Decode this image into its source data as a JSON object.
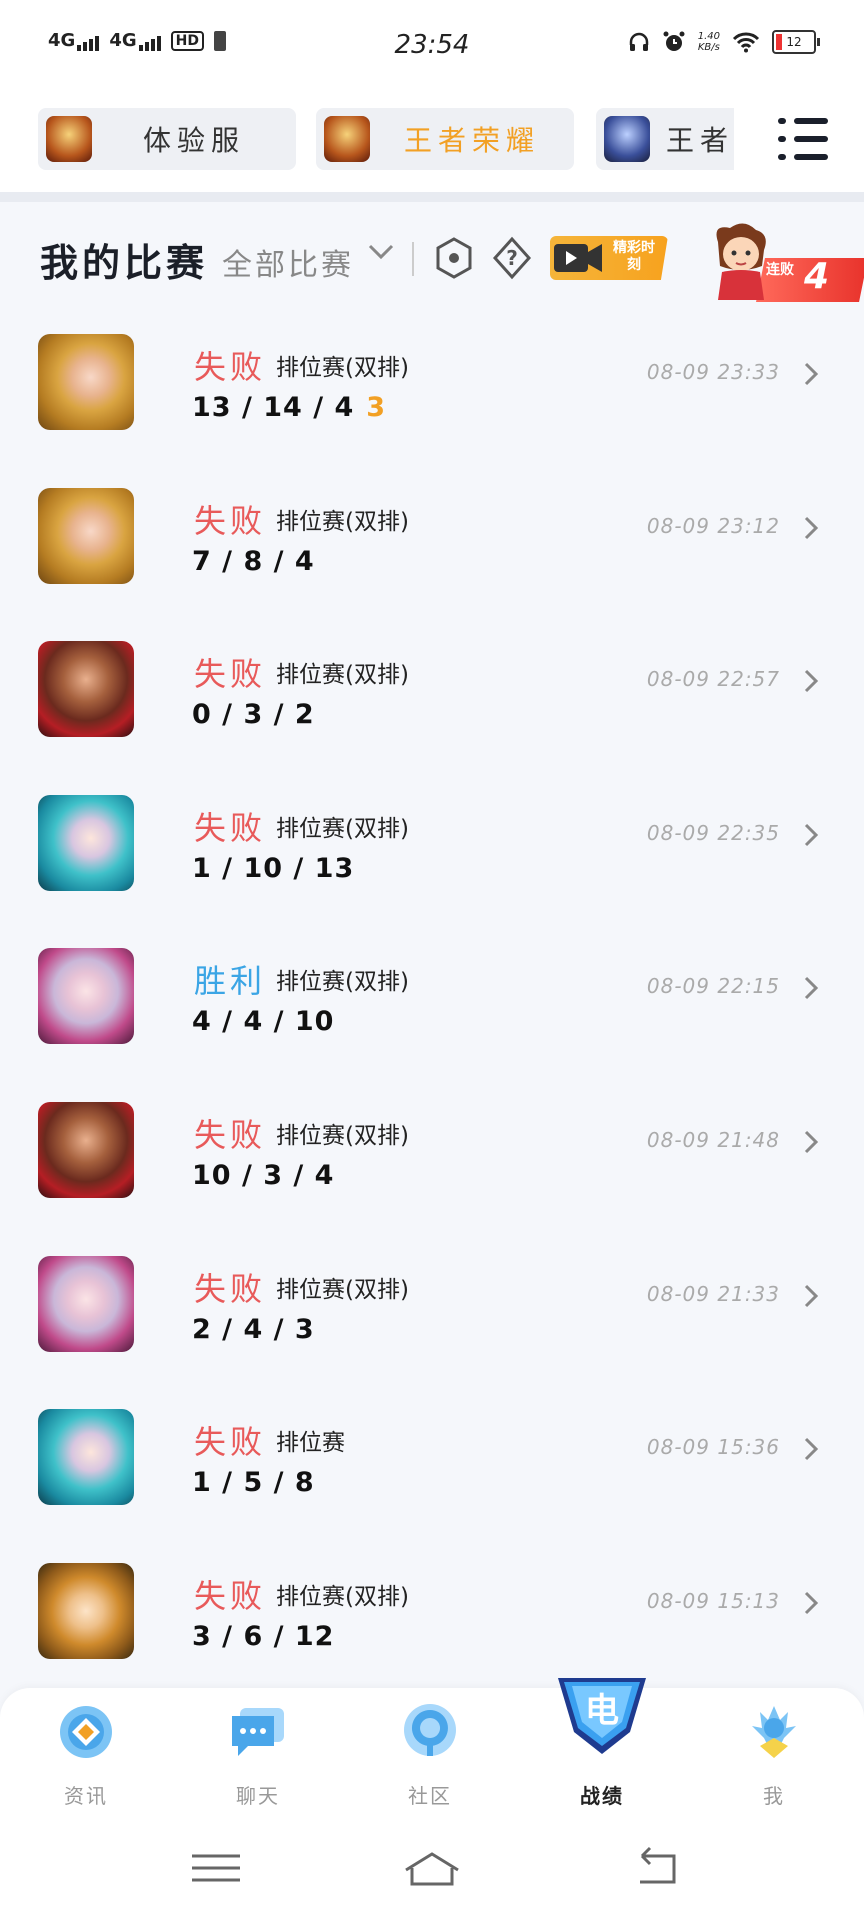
{
  "status_bar": {
    "signal1": "4G",
    "signal2": "4G",
    "hd": "HD",
    "time": "23:54",
    "net_speed_value": "1.40",
    "net_speed_unit": "KB/s",
    "battery": "12"
  },
  "game_tabs": [
    {
      "label": "体验服",
      "color": "#333333"
    },
    {
      "label": "王者荣耀",
      "color": "#f2a024"
    },
    {
      "label": "王者",
      "color": "#333333"
    }
  ],
  "header": {
    "title": "我的比赛",
    "filter": "全部比赛",
    "video_badge": "精彩时刻",
    "streak_label": "连败",
    "streak_count": "4"
  },
  "matches": [
    {
      "result": "失败",
      "result_type": "lose",
      "mode": "排位赛(双排)",
      "kda": "13 / 14 / 4",
      "extra": "3",
      "time": "08-09 23:33",
      "hero": "gold"
    },
    {
      "result": "失败",
      "result_type": "lose",
      "mode": "排位赛(双排)",
      "kda": "7 / 8 / 4",
      "extra": "",
      "time": "08-09 23:12",
      "hero": "gold"
    },
    {
      "result": "失败",
      "result_type": "lose",
      "mode": "排位赛(双排)",
      "kda": "0 / 3 / 2",
      "extra": "",
      "time": "08-09 22:57",
      "hero": "red"
    },
    {
      "result": "失败",
      "result_type": "lose",
      "mode": "排位赛(双排)",
      "kda": "1 / 10 / 13",
      "extra": "",
      "time": "08-09 22:35",
      "hero": "teal"
    },
    {
      "result": "胜利",
      "result_type": "win",
      "mode": "排位赛(双排)",
      "kda": "4 / 4 / 10",
      "extra": "",
      "time": "08-09 22:15",
      "hero": "pink"
    },
    {
      "result": "失败",
      "result_type": "lose",
      "mode": "排位赛(双排)",
      "kda": "10 / 3 / 4",
      "extra": "",
      "time": "08-09 21:48",
      "hero": "red"
    },
    {
      "result": "失败",
      "result_type": "lose",
      "mode": "排位赛(双排)",
      "kda": "2 / 4 / 3",
      "extra": "",
      "time": "08-09 21:33",
      "hero": "pink"
    },
    {
      "result": "失败",
      "result_type": "lose",
      "mode": "排位赛",
      "kda": "1 / 5 / 8",
      "extra": "",
      "time": "08-09 15:36",
      "hero": "teal"
    },
    {
      "result": "失败",
      "result_type": "lose",
      "mode": "排位赛(双排)",
      "kda": "3 / 6 / 12",
      "extra": "",
      "time": "08-09 15:13",
      "hero": "amber"
    }
  ],
  "tab_bar": [
    {
      "label": "资讯",
      "icon": "news-icon"
    },
    {
      "label": "聊天",
      "icon": "chat-icon"
    },
    {
      "label": "社区",
      "icon": "community-icon"
    },
    {
      "label": "战绩",
      "icon": "record-icon",
      "active": true
    },
    {
      "label": "我",
      "icon": "profile-icon"
    }
  ],
  "colors": {
    "lose": "#e85a5a",
    "win": "#3ba5e5",
    "accent": "#f2a024",
    "tab_blue": "#5ab4f0"
  }
}
